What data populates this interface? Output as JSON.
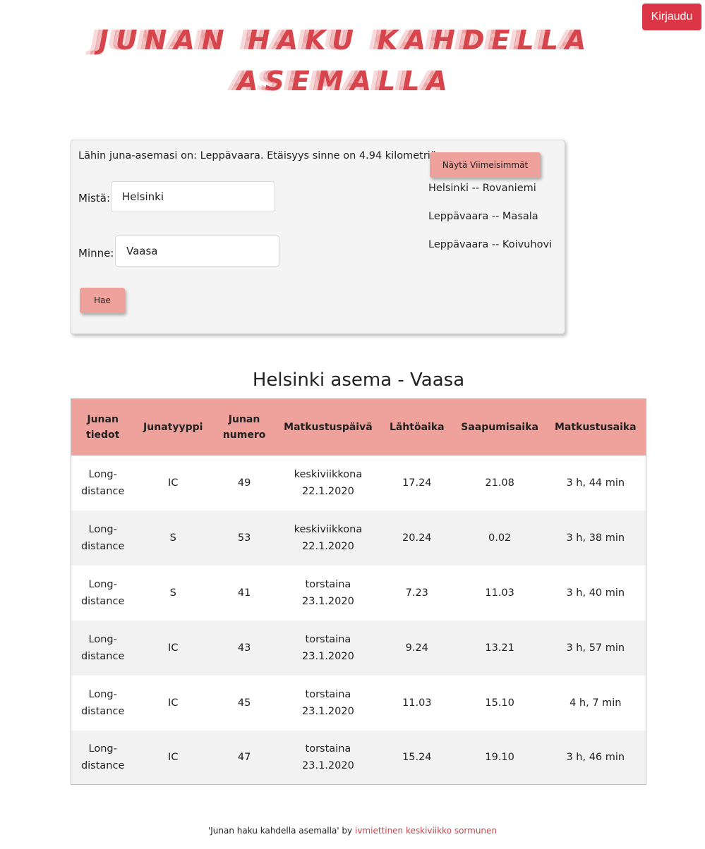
{
  "header": {
    "login_label": "Kirjaudu",
    "title_line1": "Junan haku kahdella",
    "title_line2": "asemalla"
  },
  "search": {
    "nearest_text": "Lähin juna-asemasi on: Leppävaara. Etäisyys sinne on 4.94 kilometriä.",
    "from_label": "Mistä:",
    "from_value": "Helsinki",
    "to_label": "Minne:",
    "to_value": "Vaasa",
    "submit_label": "Hae",
    "recent_button_label": "Näytä Viimeisimmät",
    "recent_items": [
      "Helsinki -- Rovaniemi",
      "Leppävaara -- Masala",
      "Leppävaara -- Koivuhovi"
    ]
  },
  "results": {
    "title": "Helsinki asema - Vaasa",
    "columns": [
      "Junan tiedot",
      "Junatyyppi",
      "Junan numero",
      "Matkustuspäivä",
      "Lähtöaika",
      "Saapumisaika",
      "Matkustusaika"
    ],
    "rows": [
      [
        "Long-distance",
        "IC",
        "49",
        "keskiviikkona 22.1.2020",
        "17.24",
        "21.08",
        "3 h, 44 min"
      ],
      [
        "Long-distance",
        "S",
        "53",
        "keskiviikkona 22.1.2020",
        "20.24",
        "0.02",
        "3 h, 38 min"
      ],
      [
        "Long-distance",
        "S",
        "41",
        "torstaina 23.1.2020",
        "7.23",
        "11.03",
        "3 h, 40 min"
      ],
      [
        "Long-distance",
        "IC",
        "43",
        "torstaina 23.1.2020",
        "9.24",
        "13.21",
        "3 h, 57 min"
      ],
      [
        "Long-distance",
        "IC",
        "45",
        "torstaina 23.1.2020",
        "11.03",
        "15.10",
        "4 h, 7 min"
      ],
      [
        "Long-distance",
        "IC",
        "47",
        "torstaina 23.1.2020",
        "15.24",
        "19.10",
        "3 h, 46 min"
      ]
    ]
  },
  "footer": {
    "text": "'Junan haku kahdella asemalla' by",
    "link_text": "ivmiettinen keskiviikko sormunen"
  },
  "colors": {
    "accent": "#eea29b",
    "title": "#d6454b",
    "login_button": "#dc3545",
    "footer_link": "#c9444c"
  }
}
